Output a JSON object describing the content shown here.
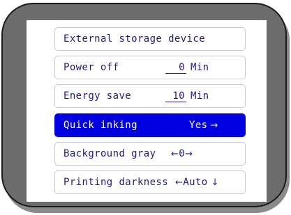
{
  "menu": {
    "items": [
      {
        "label": "External storage device"
      },
      {
        "label": "Power off",
        "value": "0",
        "unit": "Min"
      },
      {
        "label": "Energy save",
        "value": "10",
        "unit": "Min"
      },
      {
        "label": "Quick inking",
        "value": "Yes",
        "right_arrow": "→"
      },
      {
        "label": "Background gray",
        "left_arrow": "←",
        "value": "0",
        "right_arrow": "→"
      },
      {
        "label": "Printing darkness",
        "left_arrow": "←",
        "value": "Auto",
        "down_arrow": "↓"
      }
    ],
    "selected_index": 3
  },
  "colors": {
    "bezel": "#6c6c6c",
    "screen": "#ffffff",
    "selected_bg": "#0000e0",
    "text": "#1e1e78"
  }
}
